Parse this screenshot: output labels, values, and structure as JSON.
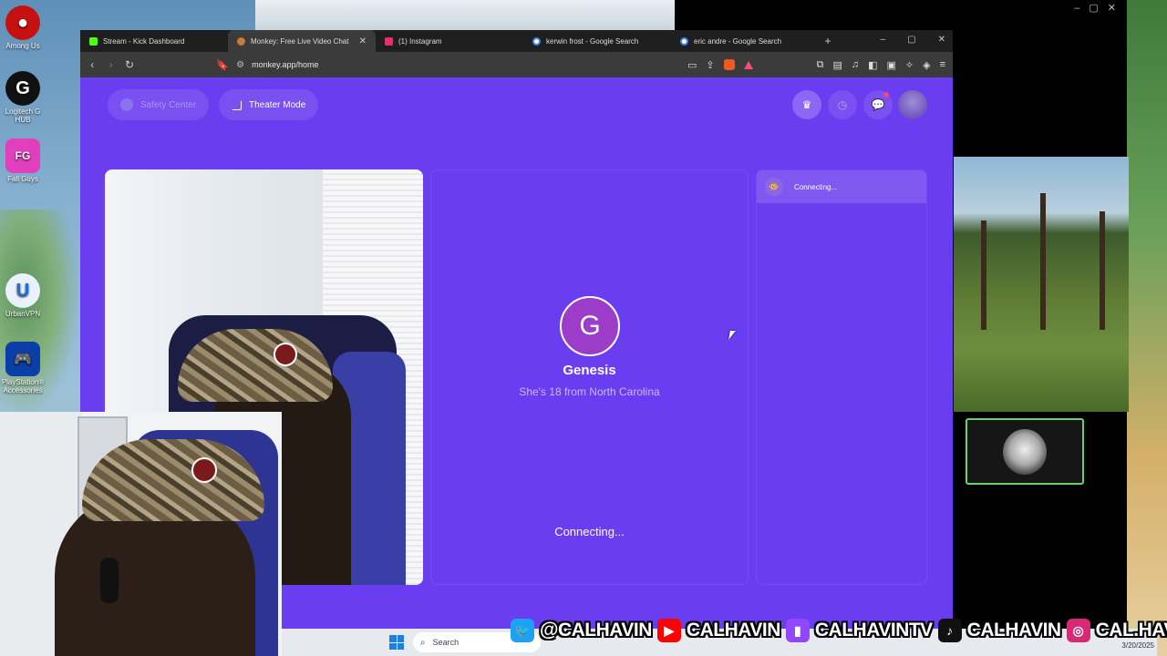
{
  "desktop": {
    "icons": [
      {
        "label": "Among Us",
        "glyph": "●",
        "color": "#c51111"
      },
      {
        "label": "Logitech G HUB",
        "glyph": "G",
        "color": "#111111"
      },
      {
        "label": "Fall Guys",
        "glyph": "FG",
        "color": "#e23fbf"
      },
      {
        "label": "UrbanVPN",
        "glyph": "U",
        "color": "#e9f1fb"
      },
      {
        "label": "PlayStation® Accessories",
        "glyph": "🎮",
        "color": "#0a3ea8"
      }
    ]
  },
  "browser": {
    "tabs": [
      {
        "label": "Stream - Kick Dashboard",
        "fav_color": "#53fc18",
        "active": false
      },
      {
        "label": "Monkey: Free Live Video Chat",
        "fav_color": "#c47b3b",
        "active": true
      },
      {
        "label": "(1) Instagram",
        "fav_color": "#e1306c",
        "active": false
      },
      {
        "label": "kerwin frost - Google Search",
        "fav_color": "#4285f4",
        "active": false
      },
      {
        "label": "eric andre - Google Search",
        "fav_color": "#4285f4",
        "active": false
      }
    ],
    "url": "monkey.app/home"
  },
  "page": {
    "safety_center": "Safety Center",
    "theater_mode": "Theater Mode",
    "peer": {
      "initial": "G",
      "name": "Genesis",
      "info": "She's 18 from North Carolina"
    },
    "status_main": "Connecting...",
    "status_side": "Connecting..."
  },
  "taskbar": {
    "search_placeholder": "Search",
    "date": "3/20/2025"
  },
  "socials": [
    {
      "icon": "twitter-icon",
      "glyph": "🐦",
      "color": "#1da1f2",
      "handle": "@CALHAVIN"
    },
    {
      "icon": "youtube-icon",
      "glyph": "▶",
      "color": "#ff0000",
      "handle": "CALHAVIN"
    },
    {
      "icon": "twitch-icon",
      "glyph": "▮",
      "color": "#9146ff",
      "handle": "CALHAVINTV"
    },
    {
      "icon": "tiktok-icon",
      "glyph": "♪",
      "color": "#111111",
      "handle": "CALHAVIN"
    },
    {
      "icon": "instagram-icon",
      "glyph": "◎",
      "color": "#d62976",
      "handle": "CAL.HAVIN"
    }
  ]
}
